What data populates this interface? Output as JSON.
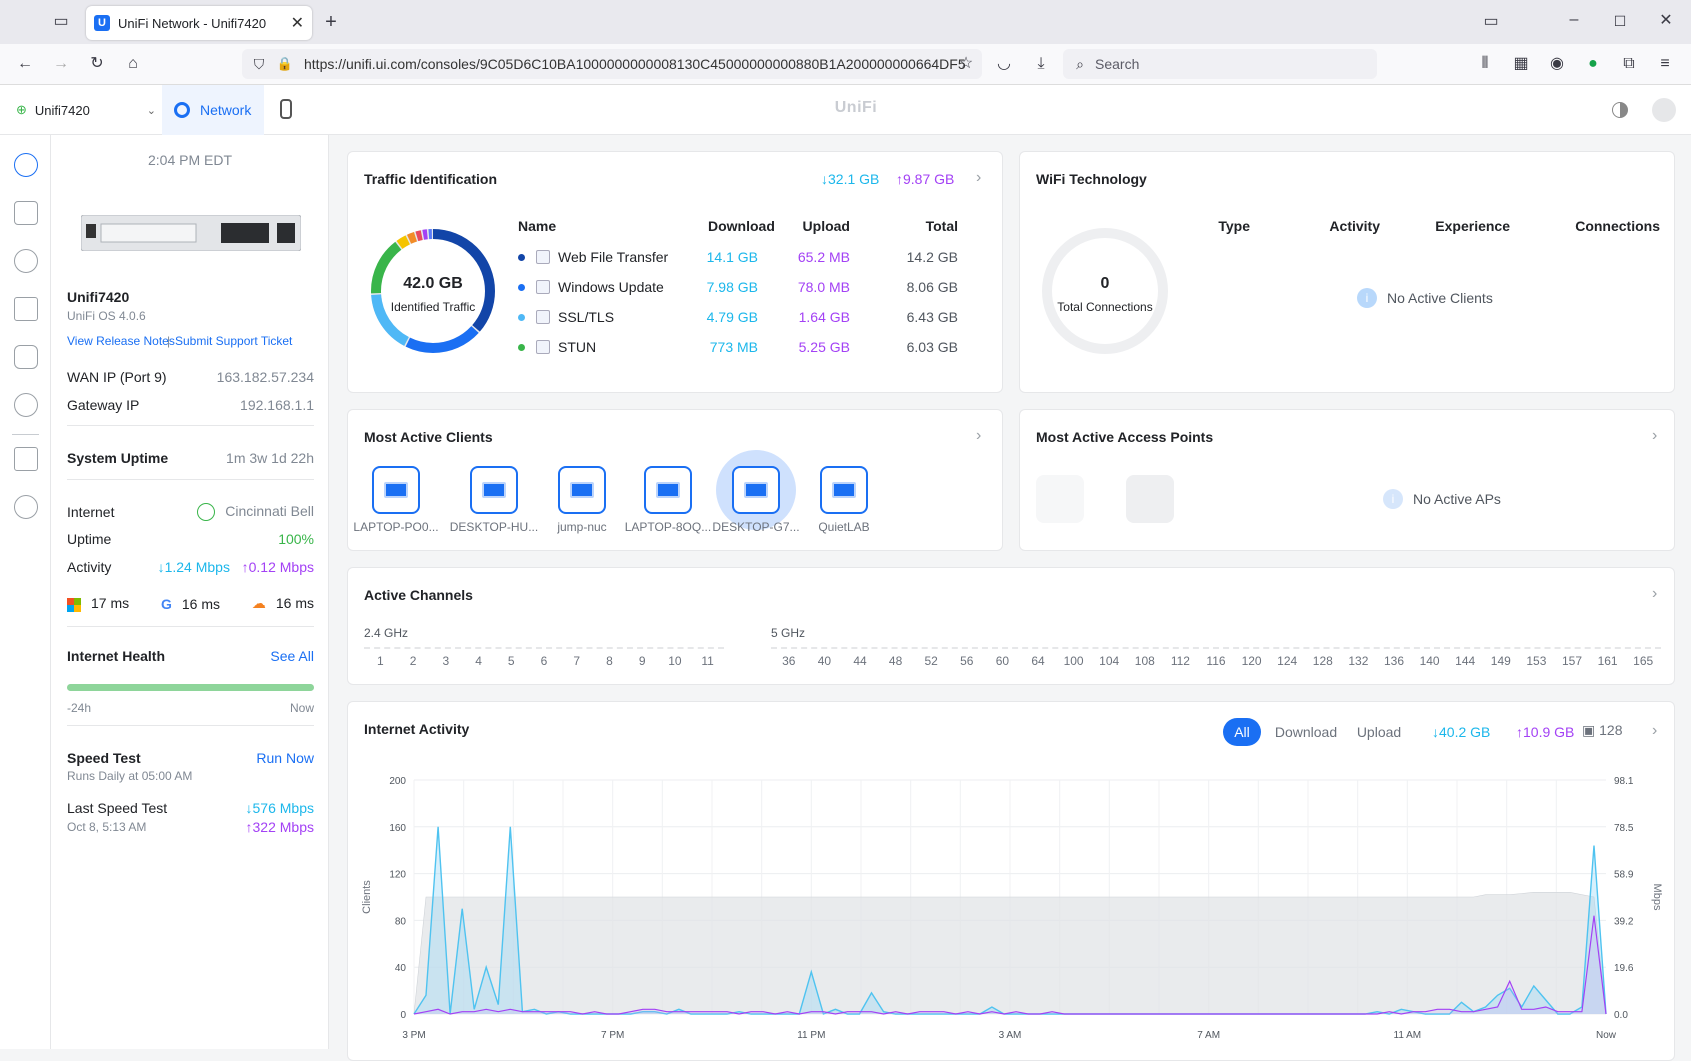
{
  "browser": {
    "tab_title": "UniFi Network - Unifi7420",
    "url": "https://unifi.ui.com/consoles/9C05D6C10BA1000000000008130C45000000000880B1A200000000664DF5",
    "search_placeholder": "Search"
  },
  "header": {
    "site": "Unifi7420",
    "app_tab": "Network",
    "brand": "UniFi"
  },
  "device": {
    "time": "2:04 PM EDT",
    "name": "Unifi7420",
    "os": "UniFi OS 4.0.6",
    "release_notes": "View Release Notes",
    "support": "Submit Support Ticket",
    "wan_label": "WAN IP (Port 9)",
    "wan_value": "163.182.57.234",
    "gw_label": "Gateway IP",
    "gw_value": "192.168.1.1",
    "uptime_label": "System Uptime",
    "uptime_value": "1m 3w 1d 22h",
    "internet_label": "Internet",
    "isp": "Cincinnati Bell",
    "uptime2_label": "Uptime",
    "uptime2_value": "100%",
    "activity_label": "Activity",
    "activity_down": "↓1.24 Mbps",
    "activity_up": "↑0.12 Mbps",
    "lat_ms": "17 ms",
    "lat_g": "16 ms",
    "lat_cf": "16 ms",
    "health_label": "Internet Health",
    "health_link": "See All",
    "health_start": "-24h",
    "health_end": "Now",
    "health_pct": 100,
    "speed_label": "Speed Test",
    "speed_link": "Run Now",
    "speed_sched": "Runs Daily at 05:00 AM",
    "last_label": "Last Speed Test",
    "last_date": "Oct 8, 5:13 AM",
    "last_down": "↓576 Mbps",
    "last_up": "↑322 Mbps"
  },
  "traffic": {
    "title": "Traffic Identification",
    "down": "↓32.1 GB",
    "up": "↑9.87 GB",
    "total": "42.0 GB",
    "total_label": "Identified Traffic",
    "headers": {
      "name": "Name",
      "download": "Download",
      "upload": "Upload",
      "total": "Total"
    },
    "rows": [
      {
        "name": "Web File Transfer",
        "download": "14.1 GB",
        "upload": "65.2 MB",
        "total": "14.2 GB",
        "color": "#1245a8"
      },
      {
        "name": "Windows Update",
        "download": "7.98 GB",
        "upload": "78.0 MB",
        "total": "8.06 GB",
        "color": "#1a6ff3"
      },
      {
        "name": "SSL/TLS",
        "download": "4.79 GB",
        "upload": "1.64 GB",
        "total": "6.43 GB",
        "color": "#4fb8f6"
      },
      {
        "name": "STUN",
        "download": "773 MB",
        "upload": "5.25 GB",
        "total": "6.03 GB",
        "color": "#39b54a"
      }
    ]
  },
  "wifi": {
    "title": "WiFi Technology",
    "count": "0",
    "count_label": "Total Connections",
    "headers": {
      "type": "Type",
      "activity": "Activity",
      "experience": "Experience",
      "connections": "Connections"
    },
    "empty": "No Active Clients"
  },
  "clients": {
    "title": "Most Active Clients",
    "items": [
      "LAPTOP-PO0...",
      "DESKTOP-HU...",
      "jump-nuc",
      "LAPTOP-8OQ...",
      "DESKTOP-G7...",
      "QuietLAB"
    ]
  },
  "aps": {
    "title": "Most Active Access Points",
    "empty": "No Active APs"
  },
  "channels": {
    "title": "Active Channels",
    "band24": "2.4 GHz",
    "band5": "5 GHz",
    "ch24": [
      "1",
      "2",
      "3",
      "4",
      "5",
      "6",
      "7",
      "8",
      "9",
      "10",
      "11"
    ],
    "ch5": [
      "36",
      "40",
      "44",
      "48",
      "52",
      "56",
      "60",
      "64",
      "100",
      "104",
      "108",
      "112",
      "116",
      "120",
      "124",
      "128",
      "132",
      "136",
      "140",
      "144",
      "149",
      "153",
      "157",
      "161",
      "165"
    ]
  },
  "activity": {
    "title": "Internet Activity",
    "tab_all": "All",
    "tab_download": "Download",
    "tab_upload": "Upload",
    "down": "↓40.2 GB",
    "up": "↑10.9 GB",
    "clients": "128"
  },
  "chart_data": {
    "type": "area",
    "ylabel": "Clients",
    "y2label": "Mbps",
    "yticks": [
      "0",
      "40",
      "80",
      "120",
      "160",
      "200"
    ],
    "y2ticks": [
      "0.0",
      "19.6",
      "39.2",
      "58.9",
      "78.5",
      "98.1"
    ],
    "ylim": [
      0,
      200
    ],
    "y2lim": [
      0,
      98.1
    ],
    "xticks": [
      "3 PM",
      "7 PM",
      "11 PM",
      "3 AM",
      "7 AM",
      "11 AM",
      "Now"
    ],
    "series": [
      {
        "name": "Clients",
        "color": "#cfd3d8",
        "values": [
          0,
          100,
          100,
          100,
          100,
          100,
          100,
          100,
          100,
          100,
          100,
          100,
          100,
          100,
          100,
          100,
          100,
          100,
          100,
          100,
          100,
          100,
          100,
          100,
          100,
          100,
          100,
          100,
          100,
          100,
          100,
          100,
          100,
          100,
          100,
          100,
          100,
          100,
          100,
          100,
          100,
          100,
          100,
          100,
          100,
          100,
          100,
          100,
          100,
          100,
          100,
          100,
          100,
          100,
          100,
          100,
          100,
          100,
          100,
          100,
          100,
          100,
          100,
          100,
          100,
          100,
          100,
          100,
          100,
          100,
          100,
          100,
          100,
          100,
          100,
          100,
          100,
          100,
          100,
          100,
          100,
          100,
          100,
          100,
          100,
          100,
          100,
          100,
          100,
          102,
          102,
          102,
          103,
          104,
          104,
          104,
          104,
          102,
          100,
          0
        ]
      },
      {
        "name": "Download",
        "color": "#4fc3f0",
        "values": [
          0,
          8,
          80,
          0,
          45,
          2,
          20,
          4,
          80,
          1,
          2,
          0,
          1,
          0,
          0,
          0,
          0,
          0,
          0,
          1,
          1,
          0,
          2,
          0,
          0,
          0,
          0,
          1,
          0,
          0,
          0,
          0,
          0,
          18,
          0,
          2,
          0,
          0,
          9,
          1,
          0,
          0,
          0,
          0,
          0,
          0,
          0,
          0,
          3,
          0,
          0,
          0,
          0,
          0,
          0,
          0,
          0,
          0,
          0,
          0,
          0,
          0,
          0,
          0,
          0,
          0,
          0,
          0,
          0,
          0,
          0,
          0,
          0,
          0,
          0,
          0,
          0,
          0,
          0,
          0,
          1,
          0,
          2,
          1,
          0,
          0,
          0,
          5,
          1,
          3,
          8,
          11,
          3,
          12,
          6,
          0,
          0,
          3,
          72,
          0
        ]
      },
      {
        "name": "Upload",
        "color": "#a341f5",
        "values": [
          0,
          1,
          2,
          0,
          1,
          1,
          2,
          1,
          2,
          1,
          1,
          1,
          1,
          1,
          0,
          1,
          0,
          0,
          1,
          2,
          2,
          1,
          1,
          1,
          1,
          1,
          1,
          0,
          1,
          1,
          0,
          1,
          0,
          1,
          1,
          0,
          1,
          1,
          1,
          0,
          1,
          0,
          1,
          1,
          1,
          0,
          1,
          0,
          1,
          0,
          1,
          0,
          0,
          1,
          0,
          0,
          0,
          0,
          0,
          0,
          0,
          0,
          0,
          0,
          0,
          0,
          0,
          0,
          0,
          0,
          0,
          0,
          0,
          0,
          0,
          0,
          0,
          0,
          0,
          0,
          0,
          1,
          0,
          1,
          1,
          2,
          2,
          1,
          1,
          2,
          3,
          14,
          2,
          2,
          3,
          1,
          1,
          1,
          42,
          0
        ]
      }
    ]
  }
}
